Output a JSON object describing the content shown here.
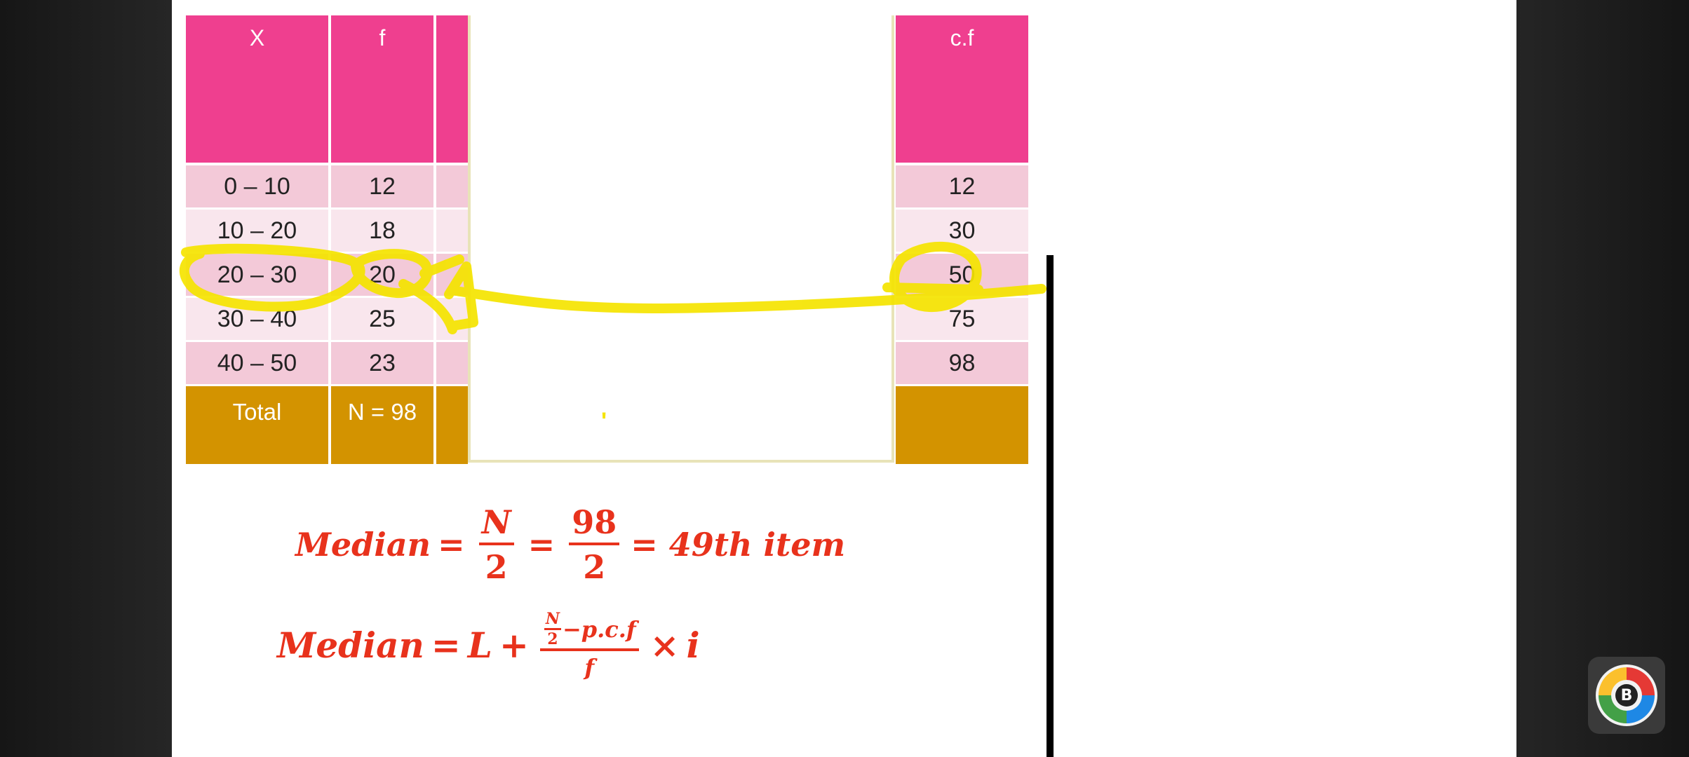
{
  "table": {
    "headers": {
      "x": "X",
      "f": "f",
      "cf": "c.f"
    },
    "rows": [
      {
        "x": "0 – 10",
        "f": "12",
        "cf": "12"
      },
      {
        "x": "10 – 20",
        "f": "18",
        "cf": "30"
      },
      {
        "x": "20 – 30",
        "f": "20",
        "cf": "50"
      },
      {
        "x": "30 – 40",
        "f": "25",
        "cf": "75"
      },
      {
        "x": "40 – 50",
        "f": "23",
        "cf": "98"
      }
    ],
    "total": {
      "label": "Total",
      "f": "N = 98",
      "cf": ""
    }
  },
  "formula1": {
    "lhs": "Median",
    "eq": "=",
    "frac1_num": "N",
    "frac1_den": "2",
    "frac2_num": "98",
    "frac2_den": "2",
    "result": "= 49th item"
  },
  "formula2": {
    "lhs": "Median",
    "eq": "=",
    "L": "L",
    "plus": "+",
    "inner_num": "N",
    "inner_den": "2",
    "minus_pcf": "−p.c.f",
    "den": "f",
    "times": "×",
    "i": "i"
  },
  "stray_mark": "'",
  "colors": {
    "header": "#ef3f8f",
    "row_dark": "#f3c9d8",
    "row_light": "#f9e6ed",
    "total": "#d39300",
    "formula": "#e8321c",
    "highlighter": "#f5e400"
  },
  "logo": {
    "letter": "B"
  }
}
